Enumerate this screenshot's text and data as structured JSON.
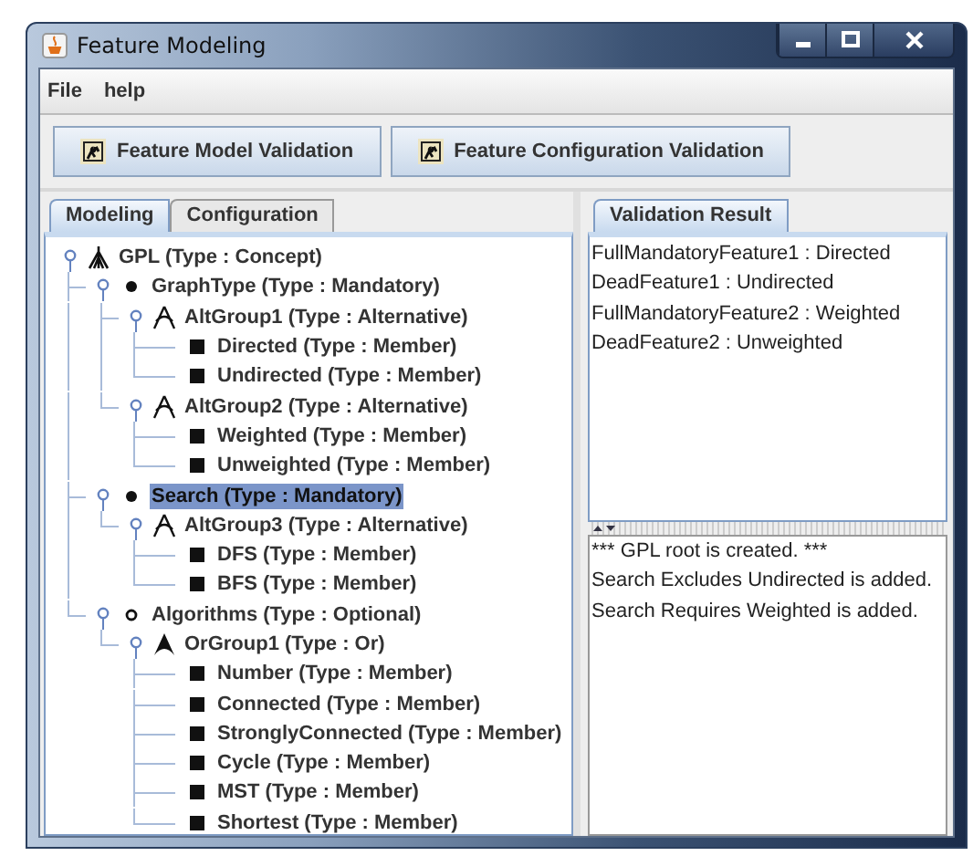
{
  "window": {
    "title": "Feature Modeling"
  },
  "menu": [
    "File",
    "help"
  ],
  "toolbar": [
    "Feature Model Validation",
    "Feature Configuration Validation"
  ],
  "left_tabs": [
    {
      "label": "Modeling",
      "selected": true
    },
    {
      "label": "Configuration",
      "selected": false
    }
  ],
  "tree": [
    {
      "label": "GPL (Type : Concept)",
      "kind": "concept",
      "selected": false,
      "children": [
        {
          "label": "GraphType (Type : Mandatory)",
          "kind": "mandatory",
          "selected": false,
          "children": [
            {
              "label": "AltGroup1 (Type : Alternative)",
              "kind": "alternative",
              "selected": false,
              "children": [
                {
                  "label": "Directed (Type : Member)",
                  "kind": "member",
                  "selected": false
                },
                {
                  "label": "Undirected (Type : Member)",
                  "kind": "member",
                  "selected": false
                }
              ]
            },
            {
              "label": "AltGroup2 (Type : Alternative)",
              "kind": "alternative",
              "selected": false,
              "children": [
                {
                  "label": "Weighted (Type : Member)",
                  "kind": "member",
                  "selected": false
                },
                {
                  "label": "Unweighted (Type : Member)",
                  "kind": "member",
                  "selected": false
                }
              ]
            }
          ]
        },
        {
          "label": "Search (Type : Mandatory)",
          "kind": "mandatory",
          "selected": true,
          "children": [
            {
              "label": "AltGroup3 (Type : Alternative)",
              "kind": "alternative",
              "selected": false,
              "children": [
                {
                  "label": "DFS (Type : Member)",
                  "kind": "member",
                  "selected": false
                },
                {
                  "label": "BFS (Type : Member)",
                  "kind": "member",
                  "selected": false
                }
              ]
            }
          ]
        },
        {
          "label": "Algorithms (Type : Optional)",
          "kind": "optional",
          "selected": false,
          "children": [
            {
              "label": "OrGroup1 (Type : Or)",
              "kind": "or",
              "selected": false,
              "children": [
                {
                  "label": "Number (Type : Member)",
                  "kind": "member",
                  "selected": false
                },
                {
                  "label": "Connected (Type : Member)",
                  "kind": "member",
                  "selected": false
                },
                {
                  "label": "StronglyConnected (Type : Member)",
                  "kind": "member",
                  "selected": false
                },
                {
                  "label": "Cycle (Type : Member)",
                  "kind": "member",
                  "selected": false
                },
                {
                  "label": "MST (Type : Member)",
                  "kind": "member",
                  "selected": false
                },
                {
                  "label": "Shortest (Type : Member)",
                  "kind": "member",
                  "selected": false
                }
              ]
            }
          ]
        }
      ]
    }
  ],
  "right_tabs": [
    {
      "label": "Validation Result",
      "selected": true
    }
  ],
  "validation_results": [
    "FullMandatoryFeature1 : Directed",
    "DeadFeature1 : Undirected",
    "FullMandatoryFeature2 : Weighted",
    "DeadFeature2 : Unweighted"
  ],
  "log": [
    "*** GPL root is created. ***",
    "Search Excludes Undirected is added.",
    "Search Requires Weighted is added."
  ]
}
